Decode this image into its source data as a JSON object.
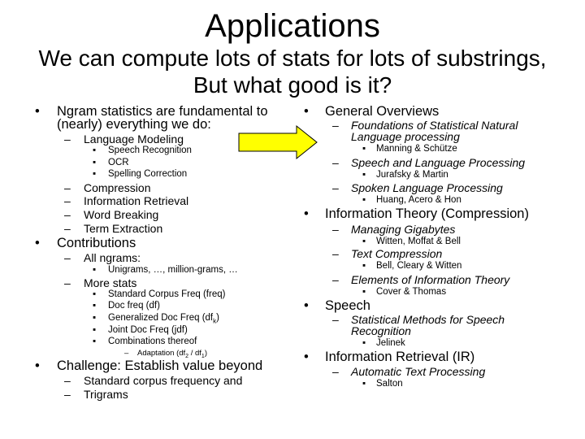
{
  "slide": {
    "title": "Applications",
    "subtitle_line1": "We can compute lots of stats for lots of substrings,",
    "subtitle_line2": "But what good is it?",
    "accent_color": "#ffff00"
  },
  "left": {
    "ngram": {
      "line1": "Ngram statistics are fundamental to",
      "line2": "(nearly) everything we do:",
      "lm": "Language Modeling",
      "lm_items": [
        "Speech Recognition",
        "OCR",
        "Spelling Correction"
      ],
      "others": [
        "Compression",
        "Information Retrieval",
        "Word Breaking",
        "Term Extraction"
      ]
    },
    "contributions": {
      "label": "Contributions",
      "all_ngrams": "All ngrams:",
      "all_ngrams_item": "Unigrams, …, million-grams, …",
      "more_stats": "More stats",
      "stats": [
        "Standard Corpus Freq (freq)",
        "Doc freq (df)",
        "Generalized Doc Freq (df",
        "Joint Doc Freq (jdf)",
        "Combinations thereof"
      ],
      "stats_sub_k": "k",
      "stats_close": ")",
      "adaptation": "Adaptation (df",
      "adaptation_sub2": "2",
      "adaptation_mid": " / df",
      "adaptation_sub1": "1",
      "adaptation_close": ")"
    },
    "challenge": {
      "label": "Challenge: Establish value beyond",
      "items": [
        "Standard corpus frequency and",
        "Trigrams"
      ]
    }
  },
  "right": {
    "general": {
      "label": "General Overviews",
      "books": [
        {
          "title_l1": "Foundations of Statistical Natural",
          "title_l2": "Language processing",
          "authors": "Manning & Schütze"
        },
        {
          "title": "Speech and Language Processing",
          "authors": "Jurafsky & Martin"
        },
        {
          "title": "Spoken Language Processing",
          "authors": "Huang, Acero & Hon"
        }
      ]
    },
    "infotheory": {
      "label": "Information Theory (Compression)",
      "books": [
        {
          "title": "Managing Gigabytes",
          "authors": "Witten, Moffat & Bell"
        },
        {
          "title": "Text Compression",
          "authors": "Bell, Cleary & Witten"
        },
        {
          "title": "Elements of Information Theory",
          "authors": "Cover & Thomas"
        }
      ]
    },
    "speech": {
      "label": "Speech",
      "book_l1": "Statistical Methods for Speech",
      "book_l2": "Recognition",
      "authors": "Jelinek"
    },
    "ir": {
      "label": "Information Retrieval (IR)",
      "book": "Automatic Text Processing",
      "authors": "Salton"
    }
  },
  "glyphs": {
    "bullet": "•",
    "dash": "–",
    "square": "▪"
  }
}
